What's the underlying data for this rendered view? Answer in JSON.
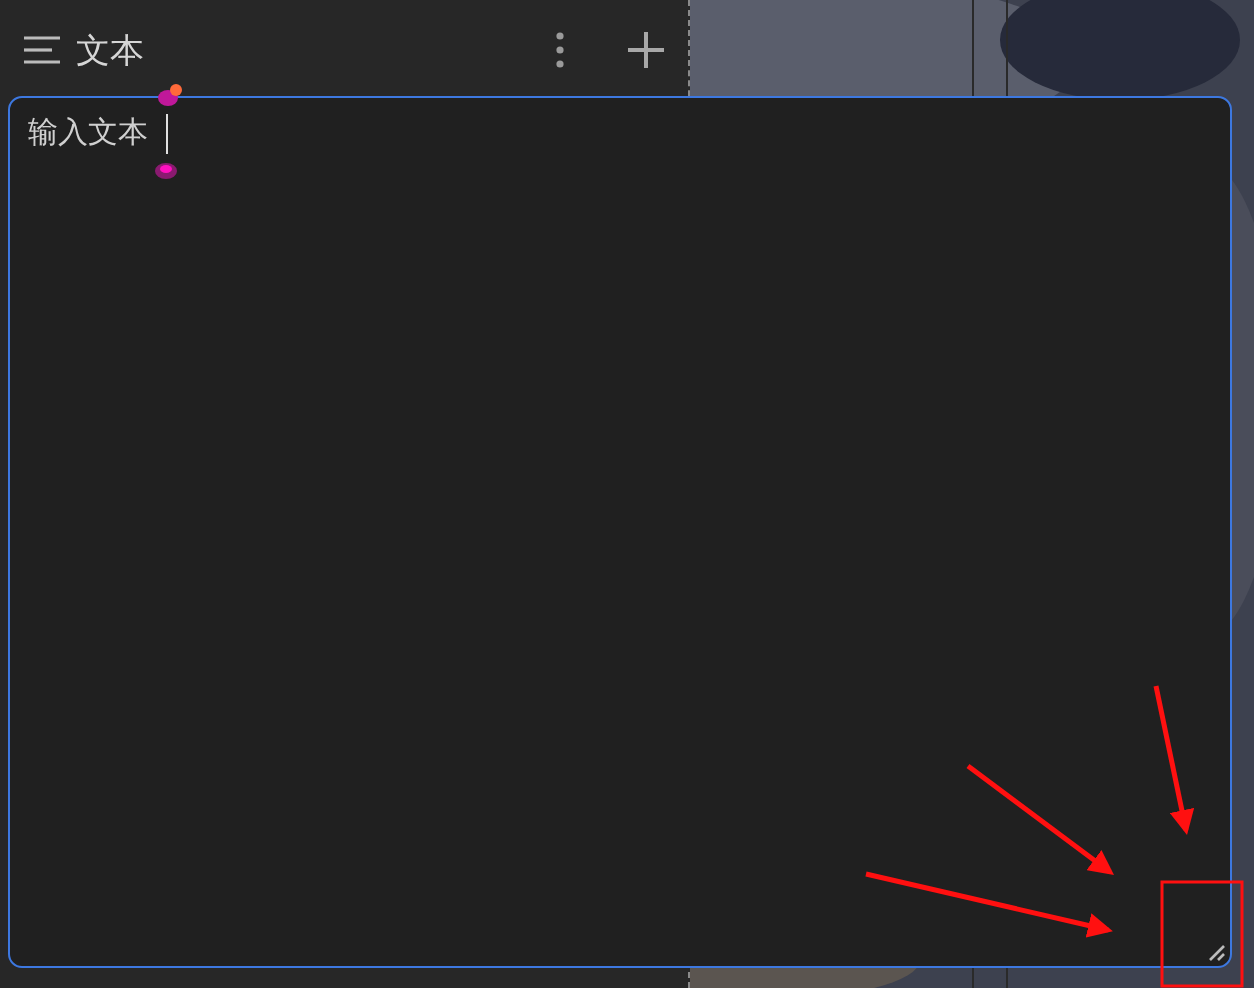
{
  "panel": {
    "title": "文本"
  },
  "text_field": {
    "value": "输入文本",
    "focused": true
  }
}
